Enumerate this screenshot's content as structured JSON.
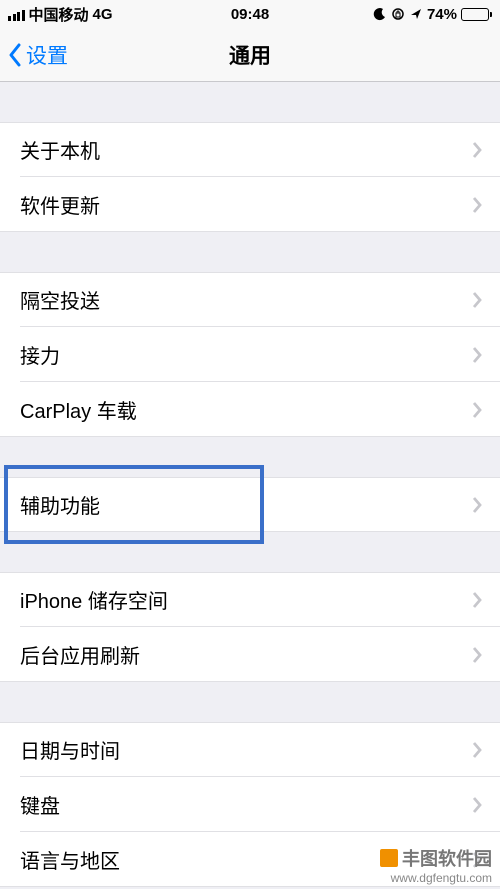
{
  "status": {
    "carrier": "中国移动",
    "network": "4G",
    "time": "09:48",
    "battery_pct": "74%"
  },
  "nav": {
    "back_label": "设置",
    "title": "通用"
  },
  "groups": [
    {
      "items": [
        {
          "label": "关于本机",
          "name": "about"
        },
        {
          "label": "软件更新",
          "name": "software-update"
        }
      ]
    },
    {
      "items": [
        {
          "label": "隔空投送",
          "name": "airdrop"
        },
        {
          "label": "接力",
          "name": "handoff"
        },
        {
          "label": "CarPlay 车载",
          "name": "carplay"
        }
      ]
    },
    {
      "items": [
        {
          "label": "辅助功能",
          "name": "accessibility",
          "highlight": true
        }
      ]
    },
    {
      "items": [
        {
          "label": "iPhone 储存空间",
          "name": "iphone-storage"
        },
        {
          "label": "后台应用刷新",
          "name": "background-refresh"
        }
      ]
    },
    {
      "items": [
        {
          "label": "日期与时间",
          "name": "date-time"
        },
        {
          "label": "键盘",
          "name": "keyboard"
        },
        {
          "label": "语言与地区",
          "name": "language-region"
        }
      ]
    }
  ],
  "watermark": {
    "title": "丰图软件园",
    "url": "www.dgfengtu.com"
  }
}
